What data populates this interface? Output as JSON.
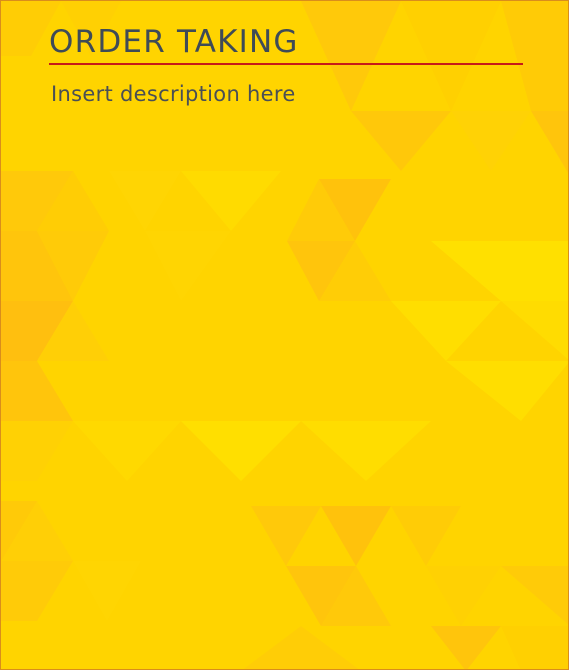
{
  "slide": {
    "title": "ORDER TAKING",
    "description": "Insert description here",
    "colors": {
      "background": "#ffd400",
      "title": "#3f4b57",
      "description": "#4a4f55",
      "rule": "#c61a1a",
      "border": "#d98d1c"
    }
  }
}
